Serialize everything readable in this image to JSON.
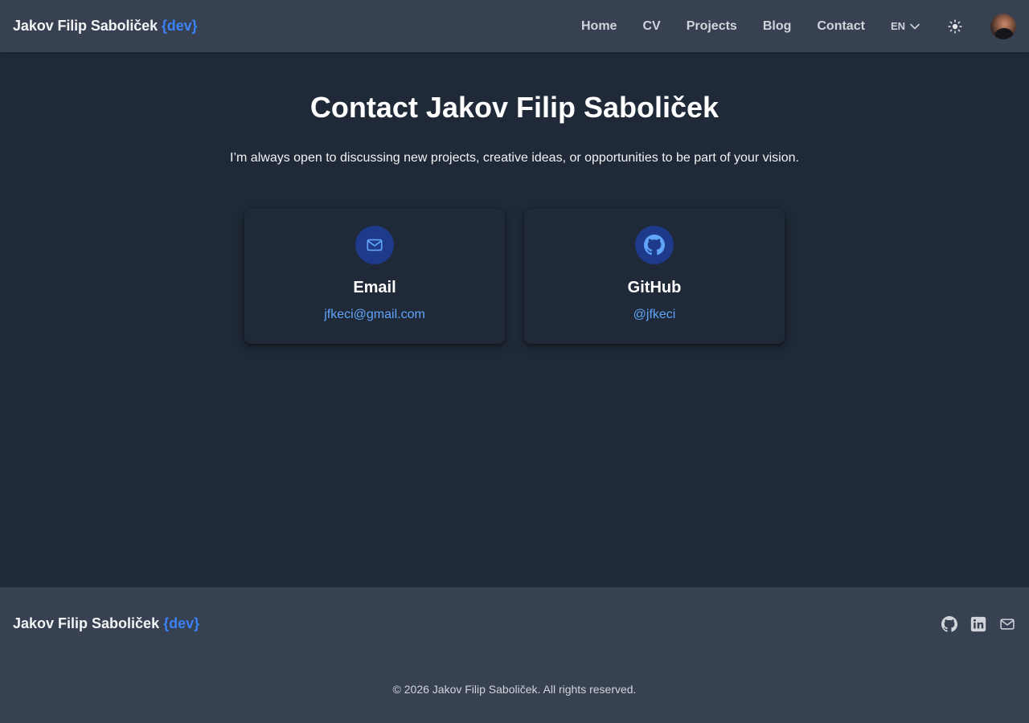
{
  "header": {
    "brand_name": "Jakov Filip Saboliček",
    "brand_accent": "{dev}",
    "nav": [
      {
        "label": "Home"
      },
      {
        "label": "CV"
      },
      {
        "label": "Projects"
      },
      {
        "label": "Blog"
      },
      {
        "label": "Contact"
      }
    ],
    "language": "EN",
    "theme_icon": "sun-icon",
    "avatar_icon": "user-avatar"
  },
  "main": {
    "title": "Contact Jakov Filip Saboliček",
    "subtitle": "I’m always open to discussing new projects, creative ideas, or opportunities to be part of your vision.",
    "cards": [
      {
        "icon": "mail-icon",
        "title": "Email",
        "value": "jfkeci@gmail.com"
      },
      {
        "icon": "github-icon",
        "title": "GitHub",
        "value": "@jfkeci"
      }
    ]
  },
  "footer": {
    "brand_name": "Jakov Filip Saboliček",
    "brand_accent": "{dev}",
    "socials": [
      "github-icon",
      "linkedin-icon",
      "mail-icon"
    ],
    "copyright": "© 2026 Jakov Filip Saboliček. All rights reserved."
  },
  "colors": {
    "background": "#1f2937",
    "header_bg": "#374151",
    "accent": "#3b82f6",
    "link": "#60a5fa",
    "icon_circle": "#1e3a8a"
  }
}
